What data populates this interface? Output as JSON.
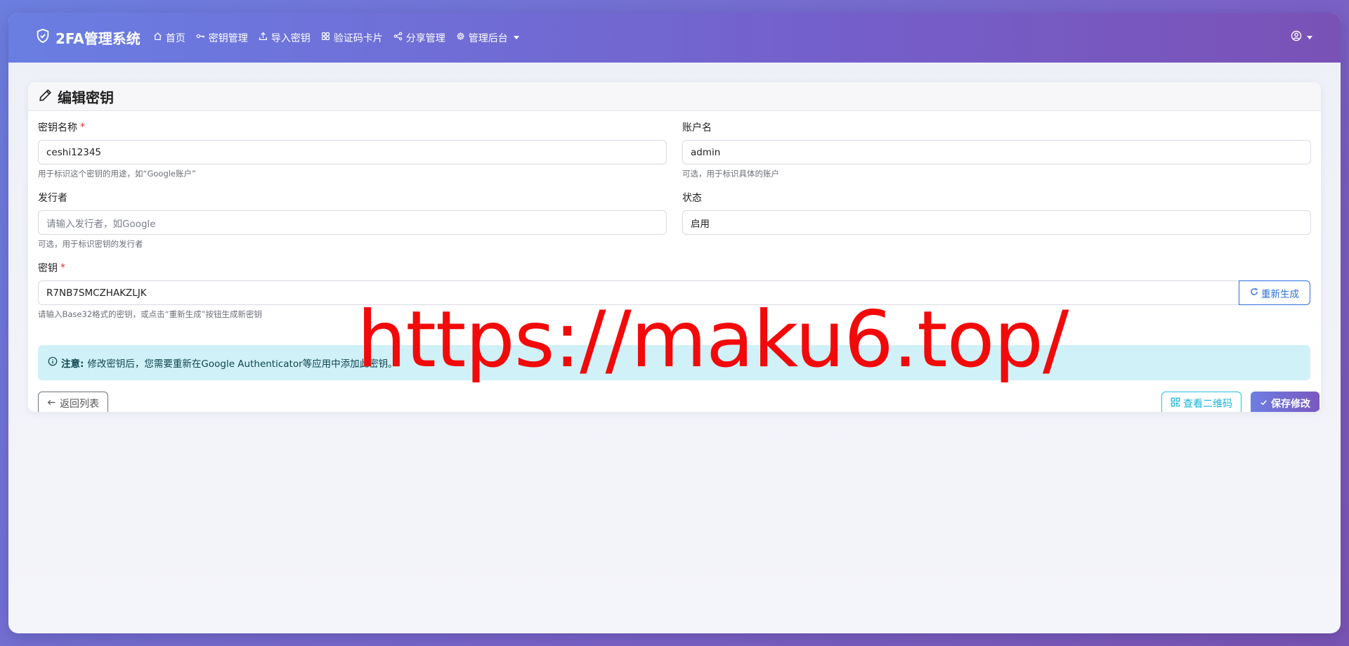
{
  "brand": {
    "title": "2FA管理系统",
    "icon": "shield-check-icon"
  },
  "nav": [
    {
      "label": "首页",
      "icon": "home-icon"
    },
    {
      "label": "密钥管理",
      "icon": "key-icon"
    },
    {
      "label": "导入密钥",
      "icon": "upload-icon"
    },
    {
      "label": "验证码卡片",
      "icon": "grid-icon"
    },
    {
      "label": "分享管理",
      "icon": "share-icon"
    },
    {
      "label": "管理后台",
      "icon": "gear-icon",
      "dropdown": true
    }
  ],
  "user_menu": {
    "icon": "user-circle-icon"
  },
  "card": {
    "title": "编辑密钥",
    "icon": "pencil-icon"
  },
  "form": {
    "name": {
      "label": "密钥名称",
      "required_mark": "*",
      "value": "ceshi12345",
      "help": "用于标识这个密钥的用途，如“Google账户”"
    },
    "account": {
      "label": "账户名",
      "value": "admin",
      "help": "可选，用于标识具体的账户"
    },
    "issuer": {
      "label": "发行者",
      "placeholder": "请输入发行者，如Google",
      "help": "可选，用于标识密钥的发行者"
    },
    "status": {
      "label": "状态",
      "value": "启用"
    },
    "secret": {
      "label": "密钥",
      "required_mark": "*",
      "value": "R7NB7SMCZHAKZLJK",
      "regen_label": "重新生成",
      "help": "请输入Base32格式的密钥，或点击“重新生成”按钮生成新密钥"
    }
  },
  "alert": {
    "title": "注意:",
    "text": "修改密钥后，您需要重新在Google Authenticator等应用中添加此密钥。"
  },
  "buttons": {
    "back": "返回列表",
    "qr": "查看二维码",
    "save": "保存修改"
  },
  "watermark": "https://maku6.top/",
  "colors": {
    "primary": "#6d7ee2",
    "info": "#13b5d6",
    "alert_bg": "#cff1f7",
    "watermark": "#f20a0a"
  }
}
